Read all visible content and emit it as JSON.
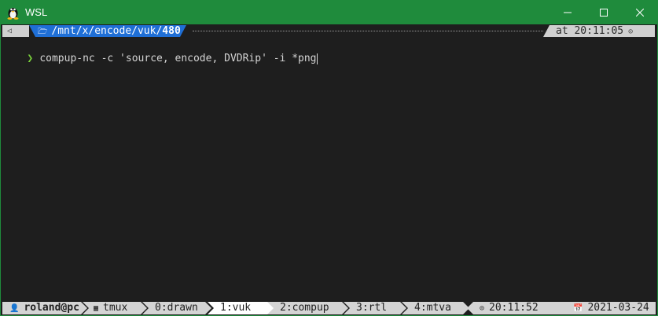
{
  "window": {
    "title": "WSL",
    "icons": {
      "app": "tux-penguin-icon",
      "minimize": "minimize-icon",
      "maximize": "maximize-icon",
      "close": "close-icon"
    },
    "colors": {
      "titlebar": "#1f8b3c",
      "terminal_bg": "#1e1e1e",
      "path_accent": "#1f6fd6",
      "prompt_arrow": "#7ad23b"
    }
  },
  "topbar": {
    "back_icon": "◁",
    "folder_icon": "🗁",
    "path_prefix": "/mnt/x/encode/vuk/",
    "path_current": "480",
    "time": "at 20:11:05",
    "clock_icon": "⊙"
  },
  "command": {
    "prompt": "❯",
    "text": "compup-nc -c 'source, encode, DVDRip' -i *png"
  },
  "statusbar": {
    "user_icon": "👤",
    "user": "roland@pc",
    "session_icon": "▦",
    "session": "tmux",
    "windows": [
      {
        "label": "0:drawn",
        "active": false
      },
      {
        "label": "1:vuk",
        "active": true
      },
      {
        "label": "2:compup",
        "active": false
      },
      {
        "label": "3:rtl",
        "active": false
      },
      {
        "label": "4:mtva",
        "active": false
      }
    ],
    "clock_icon": "⊙",
    "time": "20:11:52",
    "calendar_icon": "📅",
    "date": "2021-03-24"
  }
}
